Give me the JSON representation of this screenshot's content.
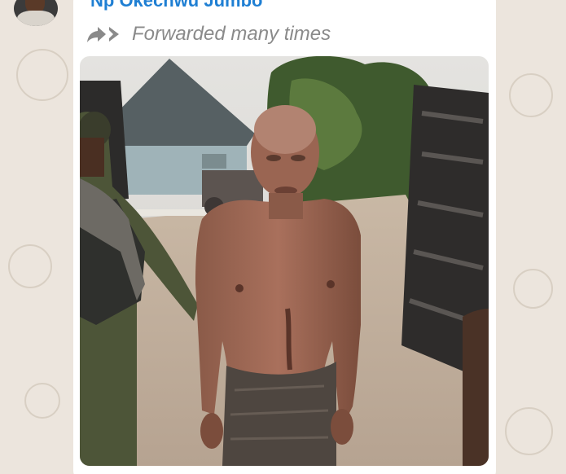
{
  "message": {
    "sender_name": "Np Okechwu Jumbo",
    "forwarded_label": "Forwarded many times",
    "forward_icon": "double-arrow-forward-icon",
    "avatar_icon": "avatar-photo",
    "photo_icon": "outdoor-photo"
  },
  "colors": {
    "chat_background": "#ece5dd",
    "bubble_background": "#ffffff",
    "sender_name": "#1f7fd3",
    "forwarded_text": "#8a8a8a"
  }
}
